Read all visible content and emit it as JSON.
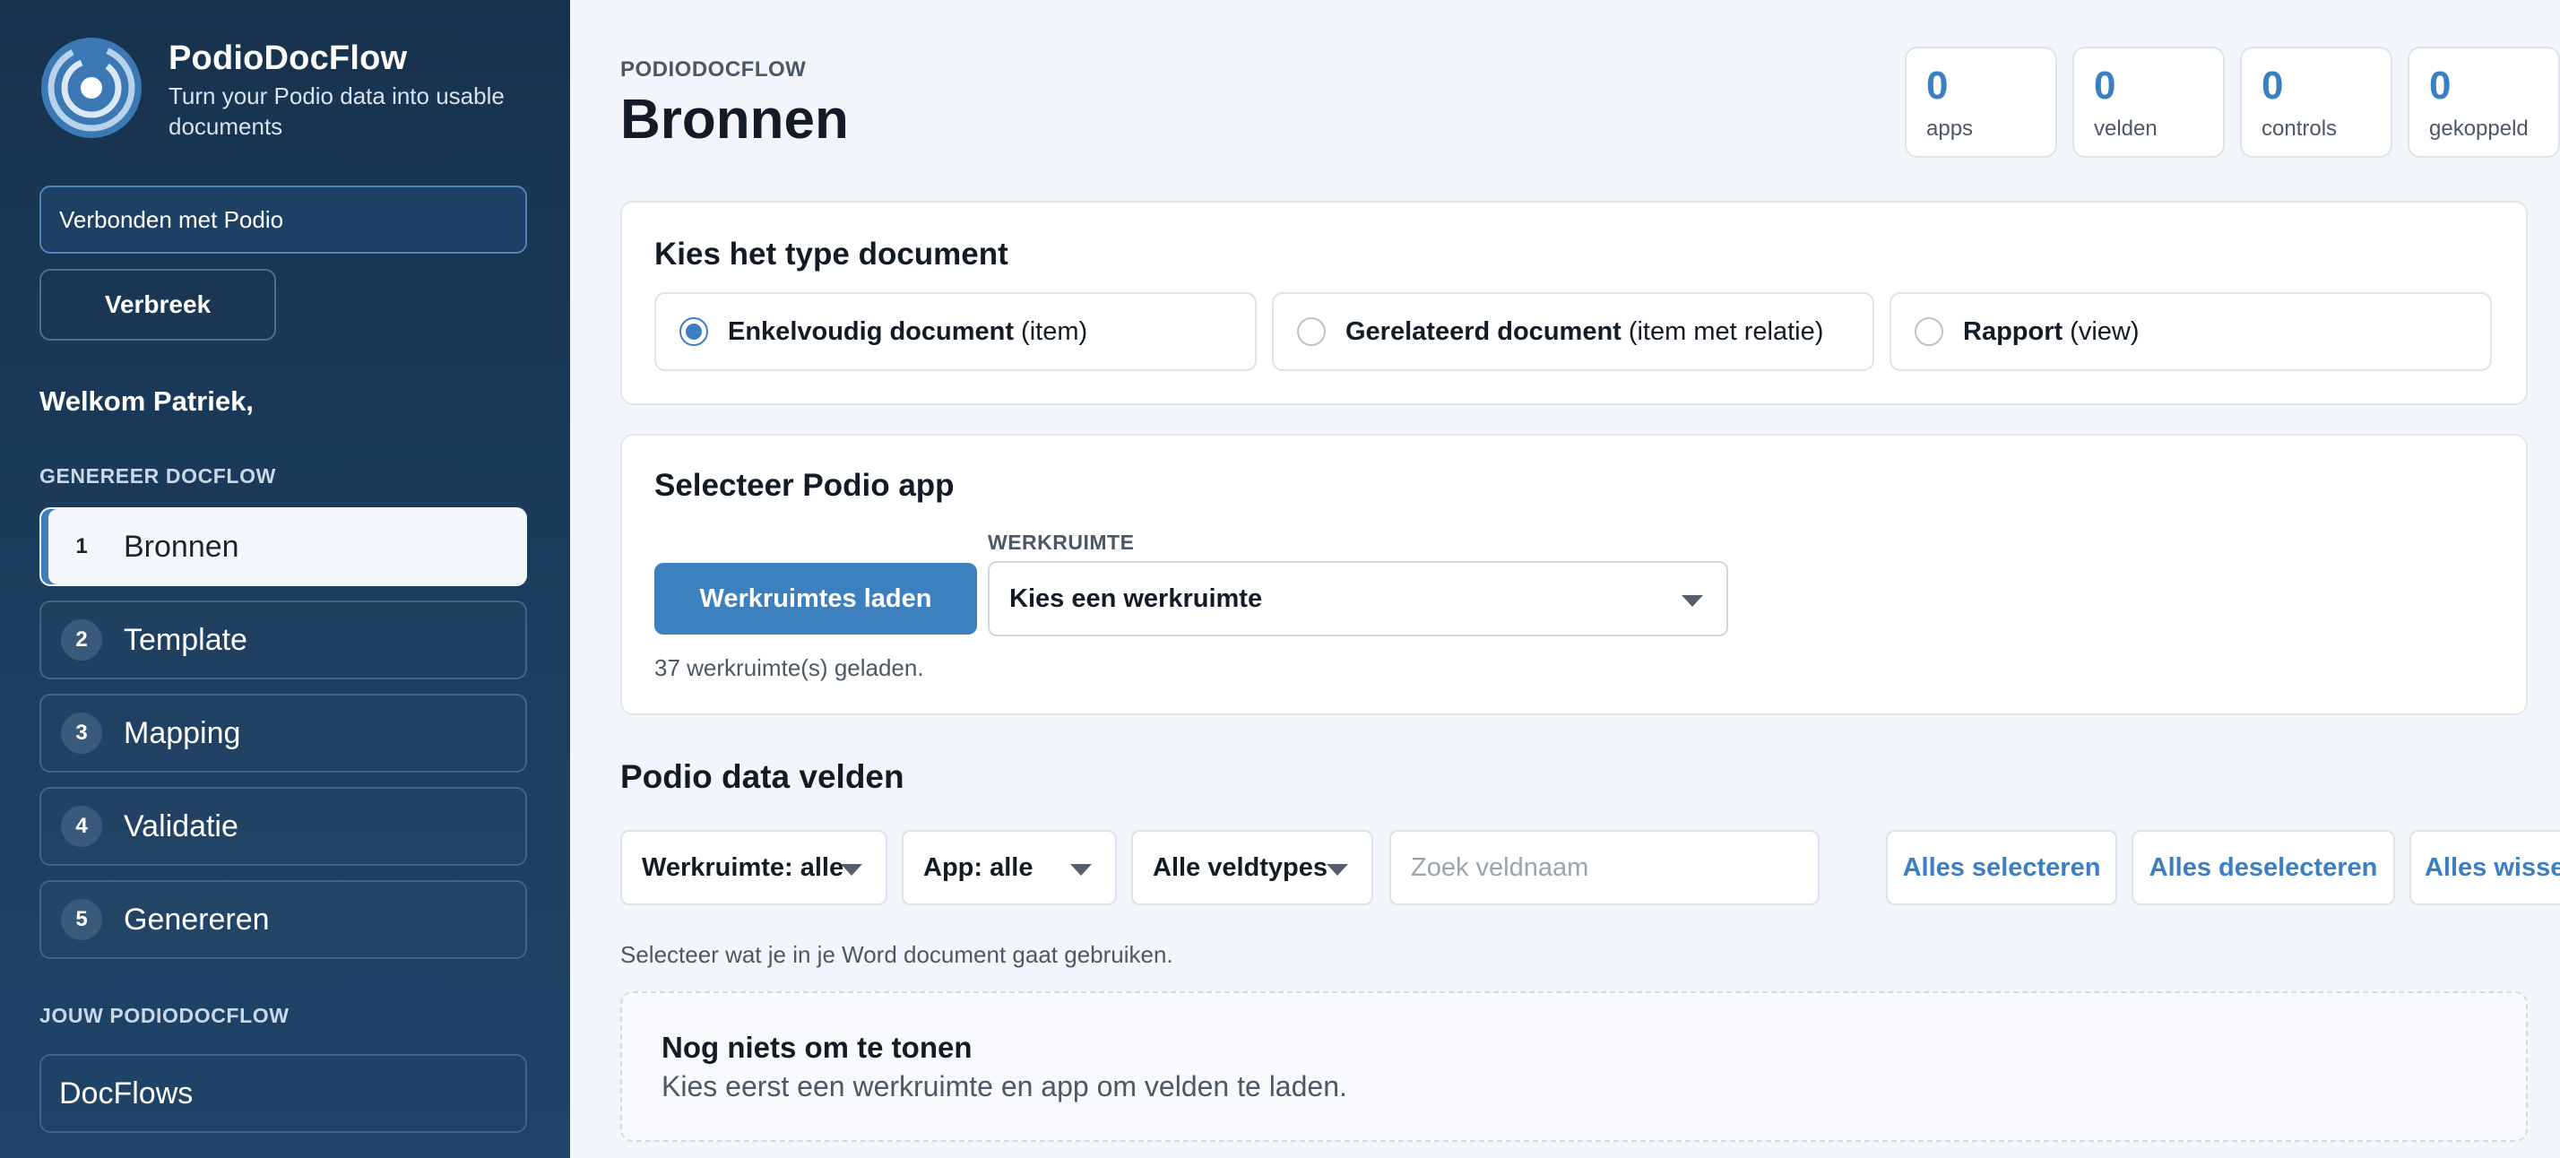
{
  "brand": {
    "name": "PodioDocFlow",
    "tagline": "Turn your Podio data into usable documents"
  },
  "sidebar": {
    "connection_status": "Verbonden met Podio",
    "disconnect_label": "Verbreek",
    "welcome": "Welkom Patriek,",
    "generate_section": "GENEREER DOCFLOW",
    "steps": [
      {
        "num": "1",
        "label": "Bronnen",
        "active": true
      },
      {
        "num": "2",
        "label": "Template"
      },
      {
        "num": "3",
        "label": "Mapping"
      },
      {
        "num": "4",
        "label": "Validatie"
      },
      {
        "num": "5",
        "label": "Genereren"
      }
    ],
    "yours_section": "JOUW PODIODOCFLOW",
    "docflows_label": "DocFlows"
  },
  "header": {
    "eyebrow": "PODIODOCFLOW",
    "title": "Bronnen"
  },
  "stats": [
    {
      "value": "0",
      "label": "apps"
    },
    {
      "value": "0",
      "label": "velden"
    },
    {
      "value": "0",
      "label": "controls"
    },
    {
      "value": "0",
      "label": "gekoppeld"
    }
  ],
  "doc_type": {
    "title": "Kies het type document",
    "options": [
      {
        "bold": "Enkelvoudig document",
        "rest": "(item)",
        "checked": true
      },
      {
        "bold": "Gerelateerd document",
        "rest": "(item met relatie)",
        "checked": false
      },
      {
        "bold": "Rapport",
        "rest": "(view)",
        "checked": false
      }
    ]
  },
  "app_select": {
    "title": "Selecteer Podio app",
    "load_button": "Werkruimtes laden",
    "workspace_label": "WERKRUIMTE",
    "workspace_value": "Kies een werkruimte",
    "note": "37 werkruimte(s) geladen."
  },
  "fields": {
    "title": "Podio data velden",
    "workspace_filter": "Werkruimte: alle",
    "app_filter": "App: alle",
    "type_filter": "Alle veldtypes",
    "search_placeholder": "Zoek veldnaam",
    "select_all": "Alles selecteren",
    "deselect_all": "Alles deselecteren",
    "clear_all": "Alles wissen",
    "hint": "Selecteer wat je in je Word document gaat gebruiken.",
    "empty_title": "Nog niets om te tonen",
    "empty_sub": "Kies eerst een werkruimte en app om velden te laden."
  },
  "colors": {
    "accent": "#3b7fc0",
    "sidebar_bg": "#17324d"
  }
}
